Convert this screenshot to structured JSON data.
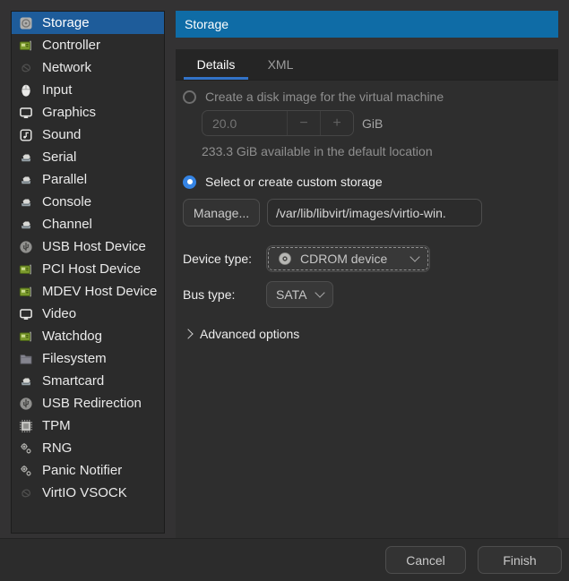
{
  "header": {
    "title": "Storage"
  },
  "tabs": {
    "details": "Details",
    "xml": "XML"
  },
  "sidebar": {
    "items": [
      {
        "label": "Storage",
        "icon": "storage-disk-icon",
        "selected": true
      },
      {
        "label": "Controller",
        "icon": "controller-board-icon"
      },
      {
        "label": "Network",
        "icon": "network-icon"
      },
      {
        "label": "Input",
        "icon": "input-mouse-icon"
      },
      {
        "label": "Graphics",
        "icon": "graphics-monitor-icon"
      },
      {
        "label": "Sound",
        "icon": "sound-icon"
      },
      {
        "label": "Serial",
        "icon": "serial-port-icon"
      },
      {
        "label": "Parallel",
        "icon": "parallel-port-icon"
      },
      {
        "label": "Console",
        "icon": "console-port-icon"
      },
      {
        "label": "Channel",
        "icon": "channel-port-icon"
      },
      {
        "label": "USB Host Device",
        "icon": "usb-icon"
      },
      {
        "label": "PCI Host Device",
        "icon": "pci-board-icon"
      },
      {
        "label": "MDEV Host Device",
        "icon": "mdev-board-icon"
      },
      {
        "label": "Video",
        "icon": "video-monitor-icon"
      },
      {
        "label": "Watchdog",
        "icon": "watchdog-board-icon"
      },
      {
        "label": "Filesystem",
        "icon": "filesystem-folder-icon"
      },
      {
        "label": "Smartcard",
        "icon": "smartcard-port-icon"
      },
      {
        "label": "USB Redirection",
        "icon": "usb-redirection-icon"
      },
      {
        "label": "TPM",
        "icon": "tpm-chip-icon"
      },
      {
        "label": "RNG",
        "icon": "rng-gears-icon"
      },
      {
        "label": "Panic Notifier",
        "icon": "panic-gears-icon"
      },
      {
        "label": "VirtIO VSOCK",
        "icon": "vsock-icon"
      }
    ]
  },
  "details": {
    "create_disk_label": "Create a disk image for the virtual machine",
    "disk_size_value": "20.0",
    "disk_size_minus": "−",
    "disk_size_plus": "+",
    "disk_size_unit": "GiB",
    "available_note": "233.3 GiB available in the default location",
    "custom_storage_label": "Select or create custom storage",
    "manage_button_label": "Manage...",
    "storage_path_value": "/var/lib/libvirt/images/virtio-win.",
    "device_type_label": "Device type:",
    "device_type_value": "CDROM device",
    "bus_type_label": "Bus type:",
    "bus_type_value": "SATA",
    "advanced_options_label": "Advanced options"
  },
  "actions": {
    "cancel_label": "Cancel",
    "finish_label": "Finish"
  },
  "colors": {
    "header_blue": "#0f6ca6",
    "sidebar_selection_blue": "#1e5c9a",
    "accent_blue": "#3584e4",
    "tab_underline_blue": "#3273c8",
    "window_bg": "#333233",
    "content_bg": "#2e2e2e"
  }
}
